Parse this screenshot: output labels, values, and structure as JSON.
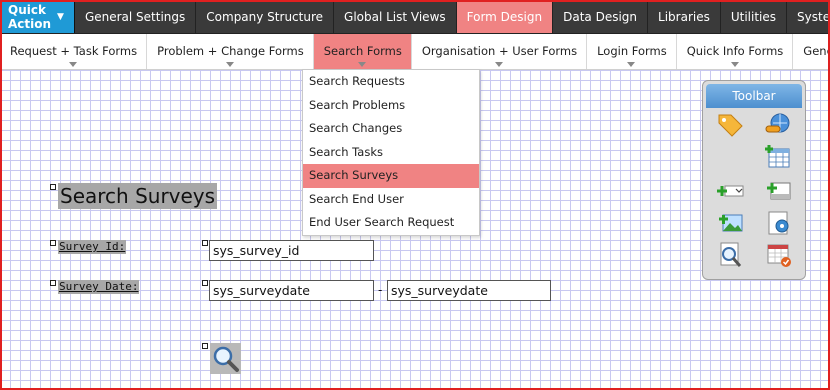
{
  "topnav": {
    "quick_action": "Quick Action",
    "items": [
      "General Settings",
      "Company Structure",
      "Global List Views",
      "Form Design",
      "Data Design",
      "Libraries",
      "Utilities",
      "System S"
    ]
  },
  "subnav": {
    "items": [
      "Request + Task Forms",
      "Problem + Change Forms",
      "Search Forms",
      "Organisation + User Forms",
      "Login Forms",
      "Quick Info Forms",
      "General Fo"
    ]
  },
  "dropdown": {
    "options": [
      "Search Requests",
      "Search Problems",
      "Search Changes",
      "Search Tasks",
      "Search Surveys",
      "Search End User",
      "End User Search Request"
    ],
    "selected": "Search Surveys"
  },
  "form": {
    "title": "Search Surveys",
    "survey_id_label": "Survey Id:",
    "survey_id_value": "sys_survey_id",
    "survey_date_label": "Survey Date:",
    "survey_date_from": "sys_surveydate",
    "range_separator": "-",
    "survey_date_to": "sys_surveydate",
    "search_icon": "magnifier-icon"
  },
  "toolbar": {
    "title": "Toolbar",
    "icons": [
      "tag-icon",
      "link-globe-icon",
      "add-table-icon",
      "add-dropdown-icon",
      "add-field-icon",
      "add-image-icon",
      "settings-icon",
      "search-preview-icon",
      "calendar-check-icon"
    ]
  },
  "colors": {
    "accent": "#1f9ad6",
    "active_tab": "#f08383",
    "nav_bg": "#3a3a3a",
    "grid_line": "#c8c8f0",
    "frame": "#e02020"
  }
}
